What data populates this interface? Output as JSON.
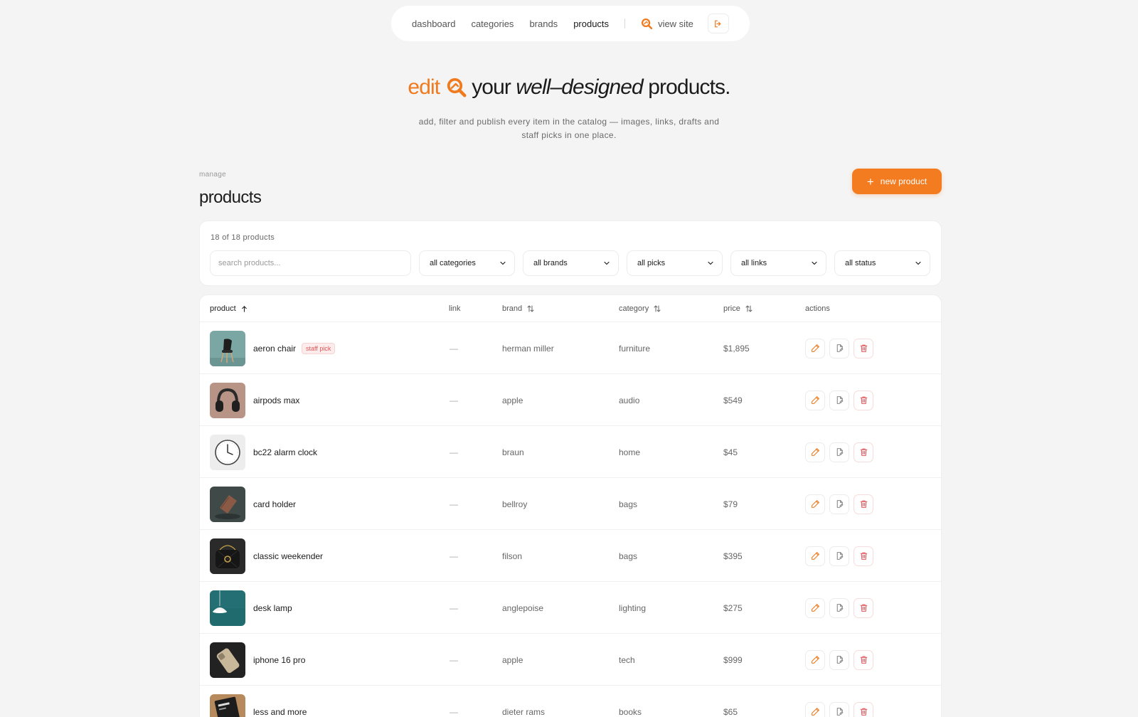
{
  "nav": {
    "links": [
      "dashboard",
      "categories",
      "brands",
      "products"
    ],
    "active": "products",
    "view_site": "view site"
  },
  "hero": {
    "edit": "edit",
    "your": "your",
    "well_designed": "well–designed",
    "products": "products.",
    "subtitle": "add, filter and publish every item in the catalog — images, links, drafts and staff picks in one place."
  },
  "header": {
    "eyebrow": "manage",
    "title": "products",
    "new_button": "new product",
    "new_button_icon": "+"
  },
  "filters": {
    "count": "18 of 18 products",
    "search_placeholder": "search products...",
    "selects": [
      "all categories",
      "all brands",
      "all picks",
      "all links",
      "all status"
    ]
  },
  "table": {
    "columns": [
      "product",
      "link",
      "brand",
      "category",
      "price",
      "actions"
    ],
    "rows": [
      {
        "name": "aeron chair",
        "badge": "staff pick",
        "link": "—",
        "brand": "herman miller",
        "category": "furniture",
        "price": "$1,895",
        "thumb": "chair"
      },
      {
        "name": "airpods max",
        "badge": "",
        "link": "—",
        "brand": "apple",
        "category": "audio",
        "price": "$549",
        "thumb": "headphones"
      },
      {
        "name": "bc22 alarm clock",
        "badge": "",
        "link": "—",
        "brand": "braun",
        "category": "home",
        "price": "$45",
        "thumb": "clock"
      },
      {
        "name": "card holder",
        "badge": "",
        "link": "—",
        "brand": "bellroy",
        "category": "bags",
        "price": "$79",
        "thumb": "wallet"
      },
      {
        "name": "classic weekender",
        "badge": "",
        "link": "—",
        "brand": "filson",
        "category": "bags",
        "price": "$395",
        "thumb": "bag"
      },
      {
        "name": "desk lamp",
        "badge": "",
        "link": "—",
        "brand": "anglepoise",
        "category": "lighting",
        "price": "$275",
        "thumb": "lamp"
      },
      {
        "name": "iphone 16 pro",
        "badge": "",
        "link": "—",
        "brand": "apple",
        "category": "tech",
        "price": "$999",
        "thumb": "phone"
      },
      {
        "name": "less and more",
        "badge": "",
        "link": "—",
        "brand": "dieter rams",
        "category": "books",
        "price": "$65",
        "thumb": "book"
      }
    ]
  },
  "icons": {
    "logo": "magnifier-logo-icon",
    "logout": "logout-icon",
    "sort": "sort-icon",
    "edit": "pencil-icon",
    "duplicate": "document-edit-icon",
    "delete": "trash-icon"
  },
  "colors": {
    "accent": "#f47c20",
    "danger": "#e0565b",
    "background": "#f4f4f4"
  }
}
